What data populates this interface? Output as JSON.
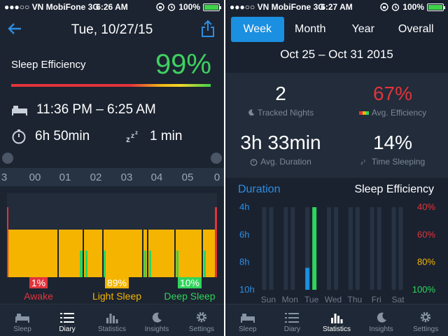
{
  "left": {
    "status": {
      "carrier": "●●●○○ VN MobiFone",
      "network": "3G",
      "time": "6:26 AM",
      "battery": "100%"
    },
    "header": {
      "date": "Tue, 10/27/15"
    },
    "efficiency": {
      "label": "Sleep Efficiency",
      "value": "99%"
    },
    "bed_time": "11:36 PM – 6:25 AM",
    "duration": "6h 50min",
    "wake_time": "1 min",
    "timeline": {
      "hours": [
        "3",
        "00",
        "01",
        "02",
        "03",
        "04",
        "05",
        "0"
      ],
      "awake": {
        "pct": "1%",
        "label": "Awake"
      },
      "light": {
        "pct": "89%",
        "label": "Light Sleep"
      },
      "deep": {
        "pct": "10%",
        "label": "Deep Sleep"
      }
    },
    "tabs": [
      {
        "label": "Sleep",
        "icon": "bed-icon"
      },
      {
        "label": "Diary",
        "icon": "list-icon"
      },
      {
        "label": "Statistics",
        "icon": "bar-chart-icon"
      },
      {
        "label": "Insights",
        "icon": "moon-icon"
      },
      {
        "label": "Settings",
        "icon": "gear-icon"
      }
    ],
    "active_tab": "Diary"
  },
  "right": {
    "status": {
      "carrier": "●●●○○ VN MobiFone",
      "network": "3G",
      "time": "6:27 AM",
      "battery": "100%"
    },
    "segments": [
      "Week",
      "Month",
      "Year",
      "Overall"
    ],
    "active_segment": "Week",
    "range": "Oct 25 – Oct 31 2015",
    "stats": {
      "tracked_nights": {
        "value": "2",
        "label": "Tracked Nights"
      },
      "avg_efficiency": {
        "value": "67%",
        "label": "Avg. Efficiency"
      },
      "avg_duration": {
        "value": "3h 33min",
        "label": "Avg. Duration"
      },
      "time_sleeping": {
        "value": "14%",
        "label": "Time Sleeping"
      }
    },
    "chart_headers": {
      "duration": "Duration",
      "efficiency": "Sleep Efficiency"
    },
    "tabs": [
      {
        "label": "Sleep",
        "icon": "bed-icon"
      },
      {
        "label": "Diary",
        "icon": "list-icon"
      },
      {
        "label": "Statistics",
        "icon": "bar-chart-icon"
      },
      {
        "label": "Insights",
        "icon": "moon-icon"
      },
      {
        "label": "Settings",
        "icon": "gear-icon"
      }
    ],
    "active_tab": "Statistics"
  },
  "chart_data": {
    "type": "bar",
    "categories": [
      "Sun",
      "Mon",
      "Tue",
      "Wed",
      "Thu",
      "Fri",
      "Sat"
    ],
    "series": [
      {
        "name": "Duration",
        "unit": "h",
        "values": [
          0,
          0,
          3.55,
          0,
          0,
          0,
          0
        ]
      },
      {
        "name": "Sleep Efficiency",
        "unit": "%",
        "values": [
          0,
          0,
          100,
          0,
          0,
          0,
          0
        ]
      }
    ],
    "left_axis": {
      "ticks": [
        "4h",
        "6h",
        "8h",
        "10h"
      ]
    },
    "right_axis": {
      "ticks": [
        "40%",
        "60%",
        "80%",
        "100%"
      ]
    },
    "colors": {
      "duration": "#1b8fe0",
      "efficiency": "#2fd45a"
    }
  },
  "colors": {
    "awake": "#e1343b",
    "light": "#f4b400",
    "deep": "#2fd45a",
    "accent": "#1b8fe0",
    "efficiency_green": "#3fd160"
  }
}
